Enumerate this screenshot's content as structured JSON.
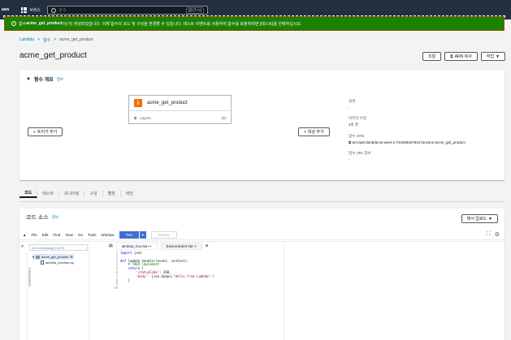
{
  "topbar": {
    "logo": "aws",
    "services": "서비스",
    "search_placeholder": "검색",
    "search_shortcut": "[옵션+S]"
  },
  "flash": {
    "prefix": "함수 ",
    "fn_name": "acme_get_product",
    "message": "이(가) 생성되었습니다. 이제 함수의 코드 및 구성을 변경할 수 있습니다. 테스트 이벤트를 사용하여 함수를 호출하려면 [테스트]를 선택하십시오."
  },
  "breadcrumb": [
    "Lambda",
    "함수",
    "acme_get_product"
  ],
  "page_title": "acme_get_product",
  "header_buttons": {
    "throttle": "조절",
    "copy_arn": "ARN 복사",
    "actions": "작업"
  },
  "overview": {
    "title": "함수 개요",
    "info": "정보",
    "function_name": "acme_get_product",
    "layers_label": "Layers",
    "layers_count": "(0)",
    "add_trigger": "트리거 추가",
    "add_destination": "대상 추가",
    "description_label": "설명",
    "description_value": "-",
    "last_modified_label": "마지막 수정",
    "last_modified_value": "2초 전",
    "arn_label": "함수 ARN",
    "arn_value": "arn:aws:lambda:us-west-2:743468197844:function:acme_get_product",
    "url_label": "함수 URL",
    "url_info": "정보",
    "url_value": "-"
  },
  "tabs": [
    "코드",
    "테스트",
    "모니터링",
    "구성",
    "별칭",
    "버전"
  ],
  "code_source": {
    "title": "코드 소스",
    "info": "정보",
    "upload": "에서 업로드",
    "menu": [
      "File",
      "Edit",
      "Find",
      "View",
      "Go",
      "Tools",
      "Window"
    ],
    "test": "Test",
    "deploy": "Deploy",
    "goto_placeholder": "Go to Anything (Ctrl-P)",
    "env_label": "Environment",
    "folder": "acme_get_product",
    "file": "lambda_function.py",
    "editor_tabs": [
      "lambda_function",
      "Environment Var"
    ],
    "line_numbers": "1\n2\n3\n4\n5\n6\n7\n8\n9\n10"
  }
}
